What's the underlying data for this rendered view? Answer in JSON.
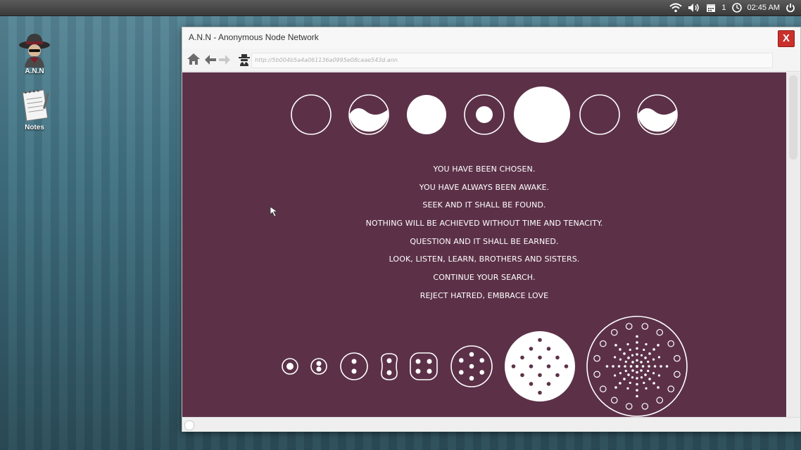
{
  "desktop": {
    "icons": [
      {
        "label": "A.N.N",
        "icon": "hacker-hat-icon"
      },
      {
        "label": "Notes",
        "icon": "notepad-icon"
      }
    ]
  },
  "panel": {
    "workspace": "1",
    "clock": "02:45 AM"
  },
  "window": {
    "title": "A.N.N - Anonymous Node Network",
    "close_label": "X",
    "url": "http://5b004b5a4a061136a0995e08caae543d.ann"
  },
  "page": {
    "background": "#5c3148",
    "messages": [
      "YOU HAVE BEEN CHOSEN.",
      "YOU HAVE ALWAYS BEEN AWAKE.",
      "SEEK AND IT SHALL BE FOUND.",
      "NOTHING WILL BE ACHIEVED WITHOUT TIME AND TENACITY.",
      "QUESTION AND IT SHALL BE EARNED.",
      "LOOK, LISTEN, LEARN, BROTHERS AND SISTERS.",
      "CONTINUE YOUR SEARCH.",
      "REJECT HATRED, EMBRACE LOVE"
    ]
  }
}
